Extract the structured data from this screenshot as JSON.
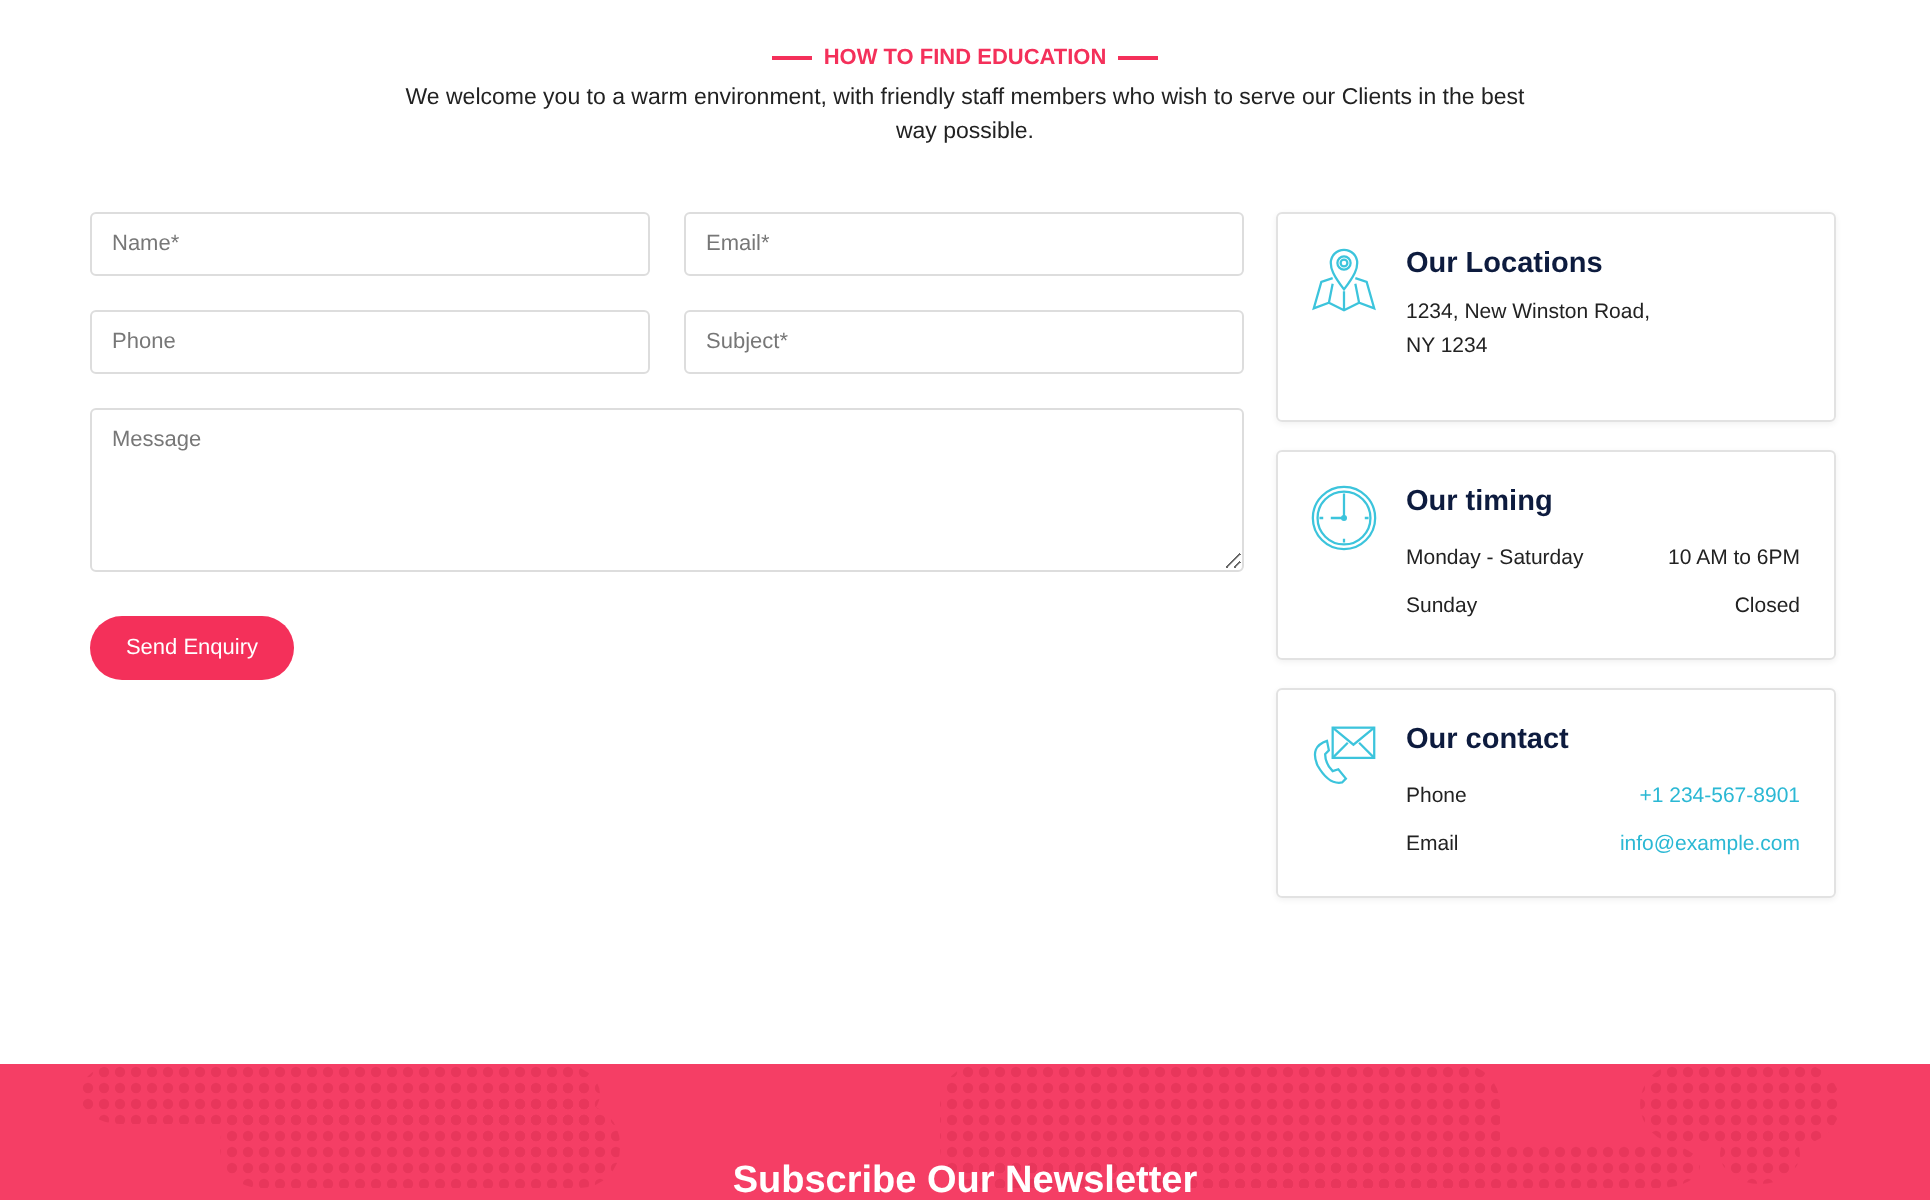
{
  "section": {
    "eyebrow": "HOW TO FIND EDUCATION",
    "intro": "We welcome you to a warm environment, with friendly staff members who wish to serve our Clients in the best way possible."
  },
  "form": {
    "fields": [
      {
        "placeholder": "Name*",
        "kind": "input"
      },
      {
        "placeholder": "Email*",
        "kind": "input"
      },
      {
        "placeholder": "Phone",
        "kind": "input"
      },
      {
        "placeholder": "Subject*",
        "kind": "input"
      },
      {
        "placeholder": "Message",
        "kind": "textarea"
      }
    ],
    "button": "Send Enquiry"
  },
  "cards": [
    {
      "title": "Our Locations",
      "kind": "lines",
      "lines": [
        "1234, New Winston Road,",
        "NY 1234"
      ]
    },
    {
      "title": "Our timing",
      "kind": "pairs",
      "rows": [
        {
          "label": "Monday - Saturday",
          "value": "10 AM to 6PM",
          "link": false
        },
        {
          "label": "Sunday",
          "value": "Closed",
          "link": false
        }
      ]
    },
    {
      "title": "Our contact",
      "kind": "pairs",
      "rows": [
        {
          "label": "Phone",
          "value": "+1 234-567-8901",
          "link": true
        },
        {
          "label": "Email",
          "value": "info@example.com",
          "link": true
        }
      ]
    }
  ],
  "newsletter": {
    "title": "Subscribe Our Newsletter"
  }
}
